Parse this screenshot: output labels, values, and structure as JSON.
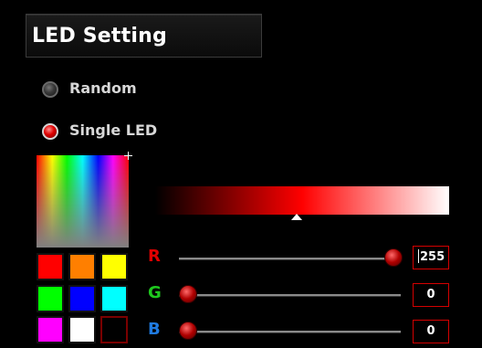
{
  "header": {
    "title": "LED Setting"
  },
  "modes": [
    {
      "label": "Random",
      "selected": false
    },
    {
      "label": "Single LED",
      "selected": true
    }
  ],
  "palette": {
    "swatches": [
      {
        "name": "red",
        "color": "#ff0000"
      },
      {
        "name": "orange",
        "color": "#ff7f00"
      },
      {
        "name": "yellow",
        "color": "#ffff00"
      },
      {
        "name": "green",
        "color": "#00ff00"
      },
      {
        "name": "blue",
        "color": "#0000ff"
      },
      {
        "name": "cyan",
        "color": "#00ffff"
      },
      {
        "name": "magenta",
        "color": "#ff00ff"
      },
      {
        "name": "white",
        "color": "#ffffff"
      },
      {
        "name": "black",
        "color": "#000000"
      }
    ]
  },
  "brightness": {
    "level": 0.47
  },
  "rgb": {
    "r": {
      "label": "R",
      "value": "255",
      "color": "#e00000"
    },
    "g": {
      "label": "G",
      "value": "0",
      "color": "#1ec81e"
    },
    "b": {
      "label": "B",
      "value": "0",
      "color": "#1f7ae0"
    }
  }
}
